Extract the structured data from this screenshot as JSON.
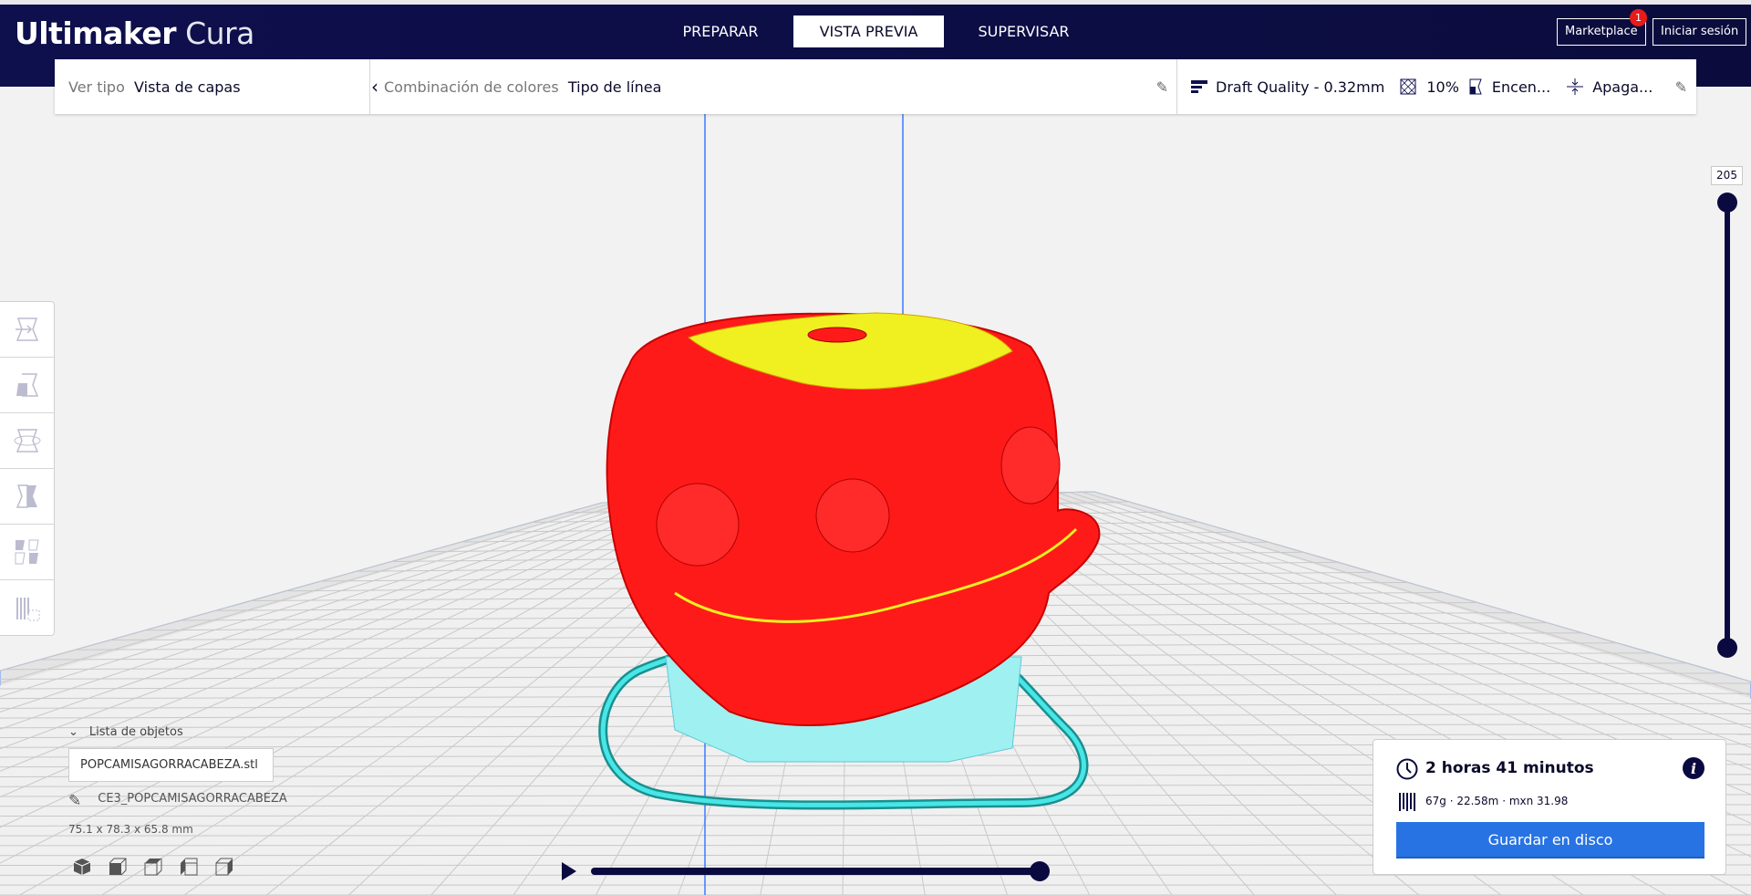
{
  "header": {
    "logo_bold": "Ultimaker",
    "logo_light": "Cura",
    "tabs": [
      {
        "label": "PREPARAR"
      },
      {
        "label": "VISTA PREVIA",
        "active": true
      },
      {
        "label": "SUPERVISAR"
      }
    ],
    "marketplace": "Marketplace",
    "marketplace_badge": "1",
    "signin": "Iniciar sesión"
  },
  "toolbar": {
    "view_type_label": "Ver tipo",
    "view_type_value": "Vista de capas",
    "color_scheme_label": "Combinación de colores",
    "color_scheme_value": "Tipo de línea",
    "quality": "Draft Quality - 0.32mm",
    "infill": "10%",
    "support": "Encen...",
    "adhesion": "Apaga..."
  },
  "layer_slider": {
    "value": "205",
    "position": 1.0
  },
  "playback": {
    "progress": 1.0
  },
  "object_list": {
    "title": "Lista de objetos",
    "item": "POPCAMISAGORRACABEZA.stl",
    "job_name": "CE3_POPCAMISAGORRACABEZA",
    "dimensions": "75.1 x 78.3 x 65.8 mm"
  },
  "print_info": {
    "time": "2 horas 41 minutos",
    "material": "67g · 22.58m · mxn 31.98",
    "save_button": "Guardar en disco"
  },
  "colors": {
    "navy": "#0e0f4d",
    "accent": "#2873e3",
    "model_red": "#ff1a1a",
    "top_yellow": "#f0f020",
    "skirt_cyan": "#40e0e0"
  }
}
